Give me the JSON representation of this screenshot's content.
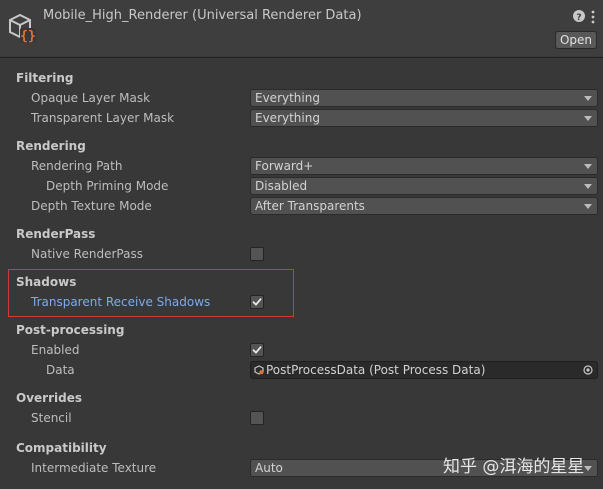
{
  "header": {
    "title": "Mobile_High_Renderer (Universal Renderer Data)",
    "open_label": "Open",
    "help_symbol": "?",
    "icons": {
      "asset": "renderer-data-asset-icon",
      "help": "help-icon",
      "menu": "kebab-menu-icon"
    }
  },
  "colors": {
    "accent_label": "#7babeb",
    "highlight_box": "#d03a3a"
  },
  "filtering": {
    "title": "Filtering",
    "opaque_layer_mask": {
      "label": "Opaque Layer Mask",
      "value": "Everything"
    },
    "transparent_layer_mask": {
      "label": "Transparent Layer Mask",
      "value": "Everything"
    }
  },
  "rendering": {
    "title": "Rendering",
    "rendering_path": {
      "label": "Rendering Path",
      "value": "Forward+"
    },
    "depth_priming_mode": {
      "label": "Depth Priming Mode",
      "value": "Disabled"
    },
    "depth_texture_mode": {
      "label": "Depth Texture Mode",
      "value": "After Transparents"
    }
  },
  "renderpass": {
    "title": "RenderPass",
    "native_renderpass": {
      "label": "Native RenderPass",
      "checked": false
    }
  },
  "shadows": {
    "title": "Shadows",
    "transparent_receive_shadows": {
      "label": "Transparent Receive Shadows",
      "checked": true
    }
  },
  "post_processing": {
    "title": "Post-processing",
    "enabled": {
      "label": "Enabled",
      "checked": true
    },
    "data": {
      "label": "Data",
      "value": "PostProcessData (Post Process Data)"
    }
  },
  "overrides": {
    "title": "Overrides",
    "stencil": {
      "label": "Stencil",
      "checked": false
    }
  },
  "compatibility": {
    "title": "Compatibility",
    "intermediate_texture": {
      "label": "Intermediate Texture",
      "value": "Auto"
    }
  },
  "watermark": "知乎 @洱海的星星"
}
